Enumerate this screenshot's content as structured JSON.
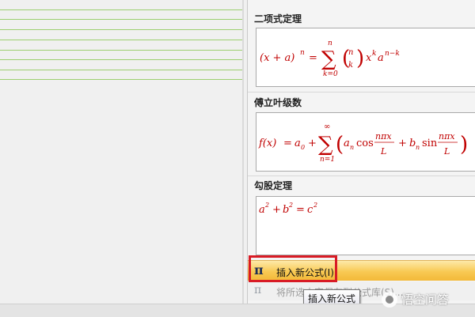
{
  "equation_gallery": {
    "sections": [
      {
        "title": "二项式定理",
        "formula": "(x + a)^n = Σ_{k=0}^{n} C(n,k) x^k a^{n−k}"
      },
      {
        "title": "傅立叶级数",
        "formula": "f(x) = a_0 + Σ_{n=1}^{∞} (a_n cos(nπx/L) + b_n sin(nπx/L))"
      },
      {
        "title": "勾股定理",
        "formula": "a^2 + b^2 = c^2"
      }
    ],
    "menu": {
      "insert_new": "插入新公式(I)",
      "save_selection": "将所选内容保存到公式库(S)..."
    },
    "tooltip": "插入新公式"
  },
  "watermark": "悟空问答",
  "colors": {
    "formula": "#c00000",
    "highlight": "#f8c953",
    "callout": "#d81b25"
  }
}
